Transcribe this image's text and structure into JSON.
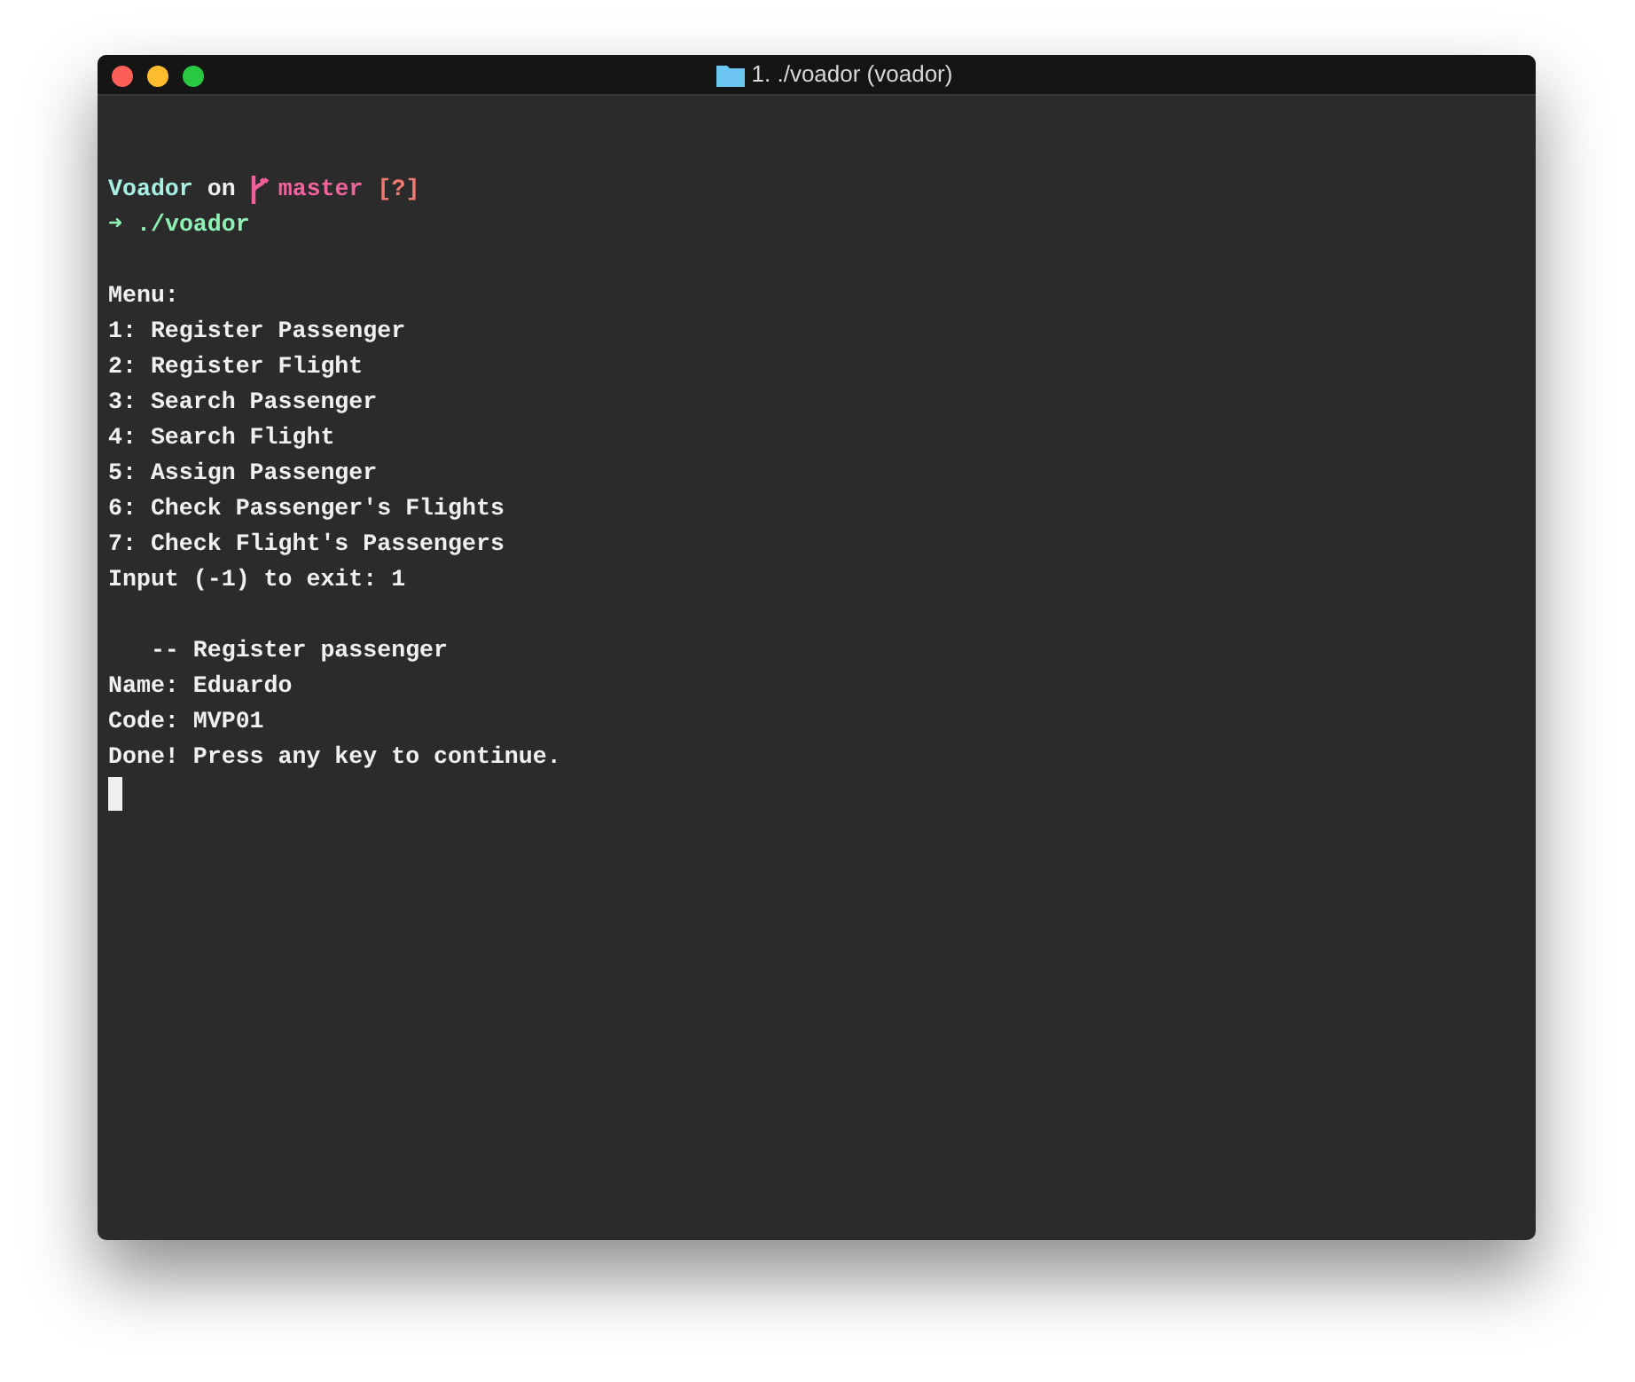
{
  "window": {
    "title": "1. ./voador (voador)"
  },
  "prompt": {
    "directory": "Voador",
    "connector": "on",
    "branch": "master",
    "status": "[?]"
  },
  "command": {
    "arrow": "➜",
    "text": "./voador"
  },
  "output": [
    {
      "kind": "blank"
    },
    {
      "kind": "text",
      "text": "Menu:"
    },
    {
      "kind": "text",
      "text": "1: Register Passenger"
    },
    {
      "kind": "text",
      "text": "2: Register Flight"
    },
    {
      "kind": "text",
      "text": "3: Search Passenger"
    },
    {
      "kind": "text",
      "text": "4: Search Flight"
    },
    {
      "kind": "text",
      "text": "5: Assign Passenger"
    },
    {
      "kind": "text",
      "text": "6: Check Passenger's Flights"
    },
    {
      "kind": "text",
      "text": "7: Check Flight's Passengers"
    },
    {
      "kind": "text",
      "text": "Input (-1) to exit: 1"
    },
    {
      "kind": "blank"
    },
    {
      "kind": "text",
      "text": "   -- Register passenger"
    },
    {
      "kind": "text",
      "text": "Name: Eduardo"
    },
    {
      "kind": "text",
      "text": "Code: MVP01"
    },
    {
      "kind": "text",
      "text": "Done! Press any key to continue."
    },
    {
      "kind": "cursor"
    }
  ]
}
